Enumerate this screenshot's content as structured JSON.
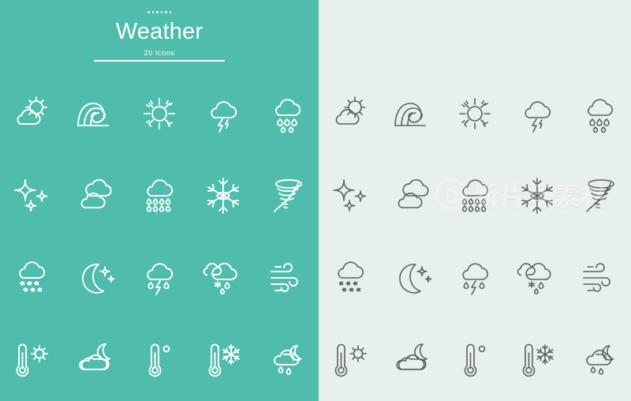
{
  "colors": {
    "panel_left_bg": "#4FBCAC",
    "panel_right_bg": "#E8F0EC",
    "stroke_left": "#FFFFFF",
    "stroke_right": "#5B6360",
    "page_bg": "#FFFFFF"
  },
  "header": {
    "dots_count": 6,
    "title": "Weather",
    "subtitle": "20 Icons"
  },
  "watermark": {
    "text": "新片场素材",
    "logo": "circle-leaf-logo"
  },
  "icons": [
    {
      "row": 1,
      "col": 1,
      "name": "partly-cloudy-icon",
      "label": "Partly Cloudy"
    },
    {
      "row": 1,
      "col": 2,
      "name": "ocean-wave-icon",
      "label": "Ocean Wave"
    },
    {
      "row": 1,
      "col": 3,
      "name": "sun-icon",
      "label": "Sun"
    },
    {
      "row": 1,
      "col": 4,
      "name": "thunderstorm-icon",
      "label": "Thunderstorm"
    },
    {
      "row": 1,
      "col": 5,
      "name": "rain-cloud-icon",
      "label": "Rain"
    },
    {
      "row": 2,
      "col": 1,
      "name": "sparkle-stars-icon",
      "label": "Clear Stars"
    },
    {
      "row": 2,
      "col": 2,
      "name": "clouds-icon",
      "label": "Cloudy"
    },
    {
      "row": 2,
      "col": 3,
      "name": "heavy-rain-cloud-icon",
      "label": "Heavy Rain"
    },
    {
      "row": 2,
      "col": 4,
      "name": "snowflake-icon",
      "label": "Snowflake"
    },
    {
      "row": 2,
      "col": 5,
      "name": "tornado-icon",
      "label": "Tornado"
    },
    {
      "row": 3,
      "col": 1,
      "name": "snow-cloud-icon",
      "label": "Snowfall"
    },
    {
      "row": 3,
      "col": 2,
      "name": "moon-stars-icon",
      "label": "Clear Night"
    },
    {
      "row": 3,
      "col": 3,
      "name": "thunderstorm-rain-icon",
      "label": "Thunder Rain"
    },
    {
      "row": 3,
      "col": 4,
      "name": "sleet-cloud-icon",
      "label": "Sleet"
    },
    {
      "row": 3,
      "col": 5,
      "name": "wind-icon",
      "label": "Wind"
    },
    {
      "row": 4,
      "col": 1,
      "name": "thermometer-sun-icon",
      "label": "Hot Temperature"
    },
    {
      "row": 4,
      "col": 2,
      "name": "cloud-moon-icon",
      "label": "Cloudy Night"
    },
    {
      "row": 4,
      "col": 3,
      "name": "thermometer-degree-icon",
      "label": "Temperature"
    },
    {
      "row": 4,
      "col": 4,
      "name": "thermometer-snowflake-icon",
      "label": "Cold Temperature"
    },
    {
      "row": 4,
      "col": 5,
      "name": "night-rain-cloud-icon",
      "label": "Night Rain"
    }
  ]
}
